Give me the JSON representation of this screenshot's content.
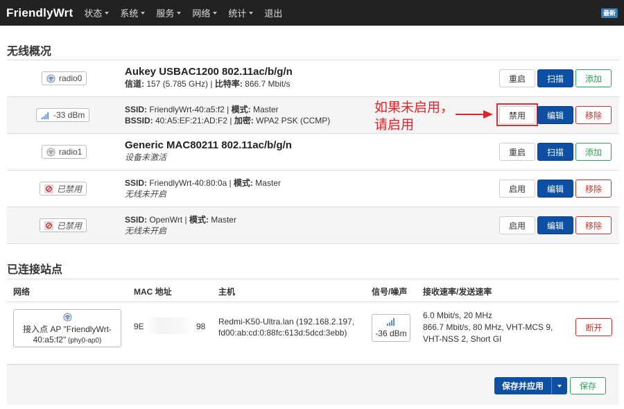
{
  "navbar": {
    "brand": "FriendlyWrt",
    "menu": [
      {
        "label": "状态",
        "has_caret": true
      },
      {
        "label": "系统",
        "has_caret": true
      },
      {
        "label": "服务",
        "has_caret": true
      },
      {
        "label": "网络",
        "has_caret": true
      },
      {
        "label": "统计",
        "has_caret": true
      },
      {
        "label": "退出",
        "has_caret": false
      }
    ],
    "new_badge": "最新"
  },
  "wireless": {
    "title": "无线概况",
    "rows": [
      {
        "badge": "radio0",
        "title": "Aukey USBAC1200 802.11ac/b/g/n",
        "l1_k1": "信道:",
        "l1_v1": " 157 (5.785 GHz) | ",
        "l1_k2": "比特率:",
        "l1_v2": " 866.7 Mbit/s",
        "buttons": [
          "重启",
          "扫描",
          "添加"
        ]
      },
      {
        "badge": "-33 dBm",
        "l1_k1": "SSID:",
        "l1_v1": " FriendlyWrt-40:a5:f2 | ",
        "l1_k2": "模式:",
        "l1_v2": " Master",
        "l2_k1": "BSSID:",
        "l2_v1": " 40:A5:EF:21:AD:F2 | ",
        "l2_k2": "加密:",
        "l2_v2": " WPA2 PSK (CCMP)",
        "buttons": [
          "禁用",
          "编辑",
          "移除"
        ]
      },
      {
        "badge": "radio1",
        "title": "Generic MAC80211 802.11ac/b/g/n",
        "note": "设备未激活",
        "buttons": [
          "重启",
          "扫描",
          "添加"
        ]
      },
      {
        "badge": "已禁用",
        "l1_k1": "SSID:",
        "l1_v1": " FriendlyWrt-40:80:0a | ",
        "l1_k2": "模式:",
        "l1_v2": " Master",
        "note": "无线未开启",
        "buttons": [
          "启用",
          "编辑",
          "移除"
        ]
      },
      {
        "badge": "已禁用",
        "l1_k1": "SSID:",
        "l1_v1": " OpenWrt | ",
        "l1_k2": "模式:",
        "l1_v2": " Master",
        "note": "无线未开启",
        "buttons": [
          "启用",
          "编辑",
          "移除"
        ]
      }
    ]
  },
  "annotation": {
    "line1": "如果未启用，",
    "line2": "请启用",
    "color": "#e0242a"
  },
  "stations": {
    "title": "已连接站点",
    "headers": [
      "网络",
      "MAC 地址",
      "主机",
      "信号/噪声",
      "接收速率/发送速率"
    ],
    "row": {
      "network_l1": "接入点 AP \"FriendlyWrt-",
      "network_l2": "40:a5:f2\"",
      "network_l2_small": " (phy0-ap0)",
      "mac_prefix": "9E",
      "mac_suffix": "98",
      "host_l1": "Redmi-K50-Ultra.lan (192.168.2.197,",
      "host_l2": "fd00:ab:cd:0:88fc:613d:5dcd:3ebb)",
      "signal": "-36 dBm",
      "rate_l1": "6.0 Mbit/s, 20 MHz",
      "rate_l2": "866.7 Mbit/s, 80 MHz, VHT-MCS 9,",
      "rate_l3": "VHT-NSS 2, Short GI",
      "disconnect": "断开"
    }
  },
  "actions": {
    "save_apply": "保存并应用",
    "save": "保存"
  }
}
